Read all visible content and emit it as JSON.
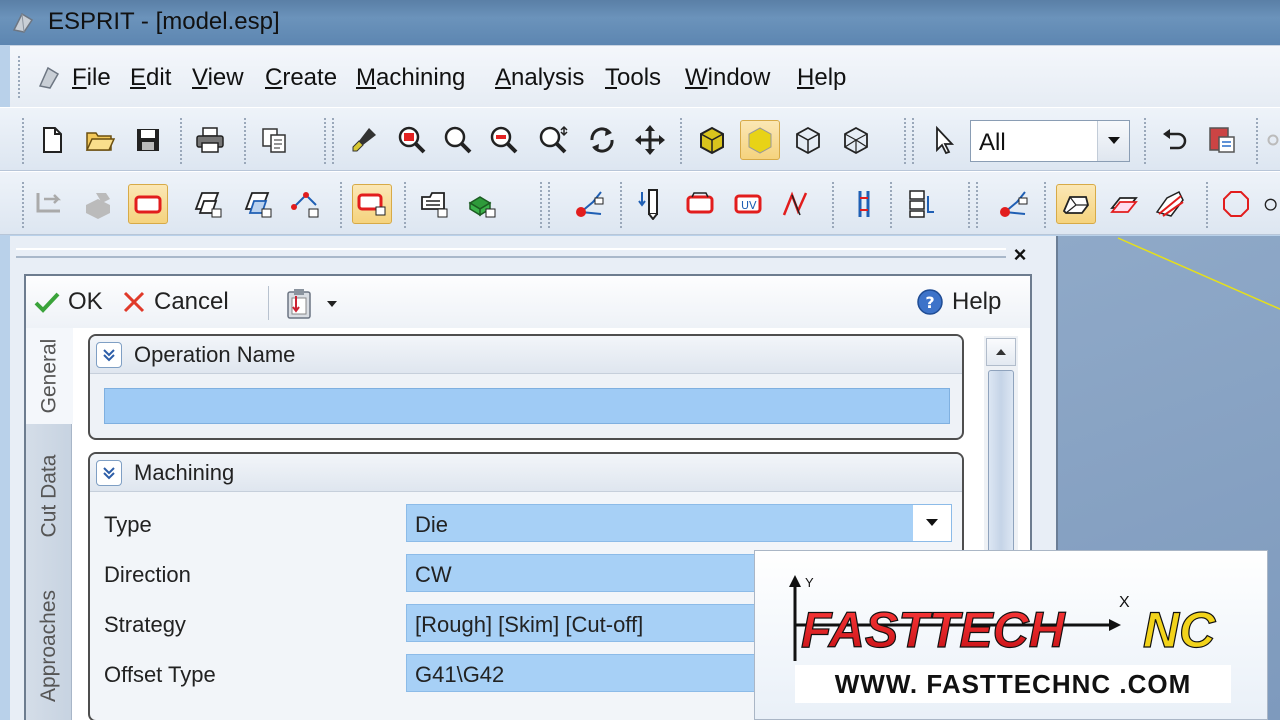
{
  "window": {
    "title": "ESPRIT - [model.esp]"
  },
  "menu": {
    "items": [
      {
        "first": "F",
        "rest": "ile"
      },
      {
        "first": "E",
        "rest": "dit"
      },
      {
        "first": "V",
        "rest": "iew"
      },
      {
        "first": "C",
        "rest": "reate"
      },
      {
        "first": "M",
        "rest": "achining"
      },
      {
        "first": "A",
        "rest": "nalysis"
      },
      {
        "first": "T",
        "rest": "ools"
      },
      {
        "first": "W",
        "rest": "indow"
      },
      {
        "first": "H",
        "rest": "elp"
      }
    ]
  },
  "toolbar": {
    "filter_value": "All"
  },
  "panel": {
    "ok_label": "OK",
    "cancel_label": "Cancel",
    "help_label": "Help",
    "tabs": [
      "General",
      "Cut Data",
      "Approaches"
    ],
    "operation_group": {
      "title": "Operation Name",
      "value": ""
    },
    "machining_group": {
      "title": "Machining",
      "rows": [
        {
          "label": "Type",
          "value": "Die"
        },
        {
          "label": "Direction",
          "value": "CW"
        },
        {
          "label": "Strategy",
          "value": "[Rough] [Skim] [Cut-off]"
        },
        {
          "label": "Offset Type",
          "value": "G41\\G42"
        }
      ]
    }
  },
  "watermark": {
    "brand_left": "FASTTECH",
    "brand_right": "NC",
    "url": "WWW. FASTTECHNC .COM",
    "axis_y": "Y",
    "axis_x": "X"
  },
  "colors": {
    "accent_field": "#a7d0f6",
    "logo_red": "#e8141c",
    "logo_blue": "#1a5fb4"
  }
}
